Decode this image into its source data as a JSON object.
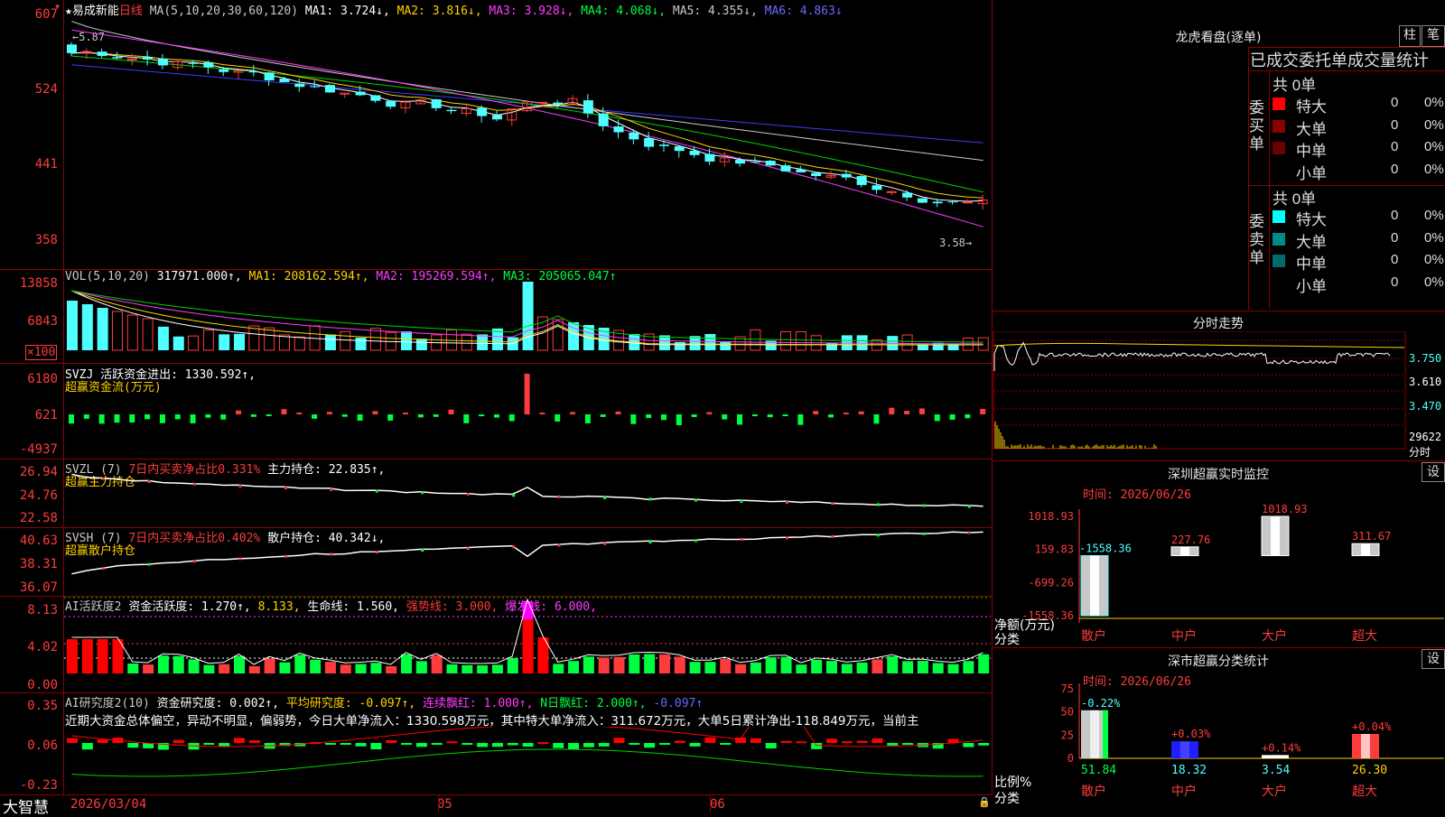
{
  "app": {
    "name": "大智慧",
    "lock_icon": "lock-icon"
  },
  "main_chart": {
    "star": "★",
    "stock_name": "易成新能",
    "period": "日线",
    "ma_label": "MA(5,10,20,30,60,120)",
    "ma1": "MA1: 3.724↓,",
    "ma2": "MA2: 3.816↓,",
    "ma3": "MA3: 3.928↓,",
    "ma4": "MA4: 4.068↓,",
    "ma5": "MA5: 4.355↓,",
    "ma6": "MA6: 4.863↓",
    "y_ticks": [
      "607",
      "524",
      "441",
      "358"
    ],
    "high_label": "5.87",
    "low_label": "3.58→",
    "colors": {
      "ma1": "#ffffff",
      "ma2": "#ffd200",
      "ma3": "#ff3cff",
      "ma4": "#00d000",
      "ma5": "#c8c8c8",
      "ma6": "#3c3cff"
    }
  },
  "volume": {
    "label": "VOL(5,10,20)",
    "value": "317971.000↑,",
    "ma1": "MA1: 208162.594↑,",
    "ma2": "MA2: 195269.594↑,",
    "ma3": "MA3: 205065.047↑",
    "y_ticks": [
      "13858",
      "6843"
    ],
    "unit": "×100"
  },
  "svzj": {
    "label": "SVZJ  活跃资金进出: 1330.592↑,",
    "subtitle": "超赢资金流(万元)",
    "y_ticks": [
      "6180",
      "621",
      "-4937"
    ]
  },
  "svzl": {
    "label": "SVZL (7)",
    "ratio": "7日内买卖净占比0.331%",
    "hold": "主力持仓: 22.835↑,",
    "subtitle": "超赢主力持仓",
    "y_ticks": [
      "26.94",
      "24.76",
      "22.58"
    ]
  },
  "svsh": {
    "label": "SVSH (7)",
    "ratio": "7日内买卖净占比0.402%",
    "hold": "散户持仓: 40.342↓,",
    "subtitle": "超赢散户持仓",
    "y_ticks": [
      "40.63",
      "38.31",
      "36.07"
    ]
  },
  "ai_active": {
    "label": "AI活跃度2",
    "v1": "资金活跃度: 1.270↑,",
    "v2": "8.133,",
    "v3": "生命线: 1.560,",
    "v4": "强势线: 3.000,",
    "v5": "爆发线: 6.000,",
    "y_ticks": [
      "8.13",
      "4.02",
      "0.00"
    ]
  },
  "ai_research": {
    "label": "AI研究度2(10)",
    "v1": "资金研究度: 0.002↑,",
    "v2": "平均研究度: -0.097↑,",
    "v3": "连续飘红: 1.000↑,",
    "v4": "N日飘红: 2.000↑,",
    "v5": "-0.097↑",
    "commentary": "近期大资金总体偏空，异动不明显，偏弱势，今日大单净流入：1330.598万元，其中特大单净流入：311.672万元，大单5日累计净出-118.849万元，当前主",
    "y_ticks": [
      "0.35",
      "0.06",
      "-0.23"
    ]
  },
  "x_axis": {
    "labels": [
      "2026/03/04",
      "05",
      "06"
    ]
  },
  "dragon_tiger": {
    "title": "龙虎看盘(逐单)",
    "btn_bar": "柱",
    "btn_stroke": "笔",
    "header": "已成交委托单成交量统计",
    "buy_side": "委买单",
    "sell_side": "委卖单",
    "buy_total": "共 0单",
    "sell_total": "共 0单",
    "buy_rows": [
      {
        "label": "特大",
        "count": "0",
        "pct": "0%",
        "color": "#ff0000"
      },
      {
        "label": "大单",
        "count": "0",
        "pct": "0%",
        "color": "#8b0000"
      },
      {
        "label": "中单",
        "count": "0",
        "pct": "0%",
        "color": "#6b0000"
      },
      {
        "label": "小单",
        "count": "0",
        "pct": "0%",
        "color": "#000000"
      }
    ],
    "sell_rows": [
      {
        "label": "特大",
        "count": "0",
        "pct": "0%",
        "color": "#00ffff"
      },
      {
        "label": "大单",
        "count": "0",
        "pct": "0%",
        "color": "#008b8b"
      },
      {
        "label": "中单",
        "count": "0",
        "pct": "0%",
        "color": "#006b6b"
      },
      {
        "label": "小单",
        "count": "0",
        "pct": "0%",
        "color": "#000000"
      }
    ]
  },
  "intraday": {
    "title": "分时走势",
    "y_ticks": [
      "3.750",
      "3.610",
      "3.470"
    ],
    "vol_label": "29622",
    "time_label": "分时"
  },
  "monitor": {
    "title": "深圳超赢实时监控",
    "settings_btn": "设",
    "date": "时间: 2026/06/26",
    "y_ticks": [
      "1018.93",
      "159.83",
      "-699.26",
      "-1558.36"
    ],
    "ylabel": "净额(万元)",
    "xlabel": "分类",
    "categories": [
      "散户",
      "中户",
      "大户",
      "超大"
    ],
    "value_labels": [
      "-1558.36",
      "227.76",
      "1018.93",
      "311.67"
    ]
  },
  "classify": {
    "title": "深市超赢分类统计",
    "settings_btn": "设",
    "date": "时间: 2026/06/26",
    "y_ticks": [
      "75",
      "50",
      "25",
      "0"
    ],
    "ylabel": "比例%",
    "xlabel": "分类",
    "categories": [
      "散户",
      "中户",
      "大户",
      "超大"
    ],
    "top_labels": [
      "-0.22%",
      "+0.03%",
      "+0.14%",
      "+0.04%"
    ],
    "bottom_labels": [
      "51.84",
      "18.32",
      "3.54",
      "26.30"
    ]
  },
  "chart_data": [
    {
      "type": "bar",
      "title": "深圳超赢实时监控",
      "xlabel": "分类",
      "ylabel": "净额(万元)",
      "categories": [
        "散户",
        "中户",
        "大户",
        "超大"
      ],
      "values": [
        -1558.36,
        227.76,
        1018.93,
        311.67
      ],
      "ylim": [
        -1558.36,
        1018.93
      ]
    },
    {
      "type": "bar",
      "title": "深市超赢分类统计",
      "xlabel": "分类",
      "ylabel": "比例%",
      "categories": [
        "散户",
        "中户",
        "大户",
        "超大"
      ],
      "values": [
        51.84,
        18.32,
        3.54,
        26.3
      ],
      "change": [
        "-0.22%",
        "+0.03%",
        "+0.14%",
        "+0.04%"
      ],
      "ylim": [
        0,
        75
      ]
    }
  ]
}
